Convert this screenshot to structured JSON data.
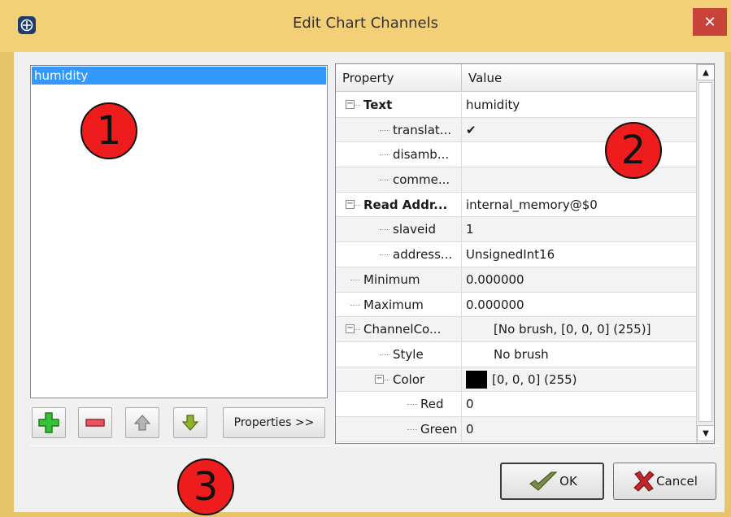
{
  "window": {
    "title": "Edit Chart Channels",
    "close_glyph": "✕"
  },
  "channel_list": {
    "items": [
      {
        "label": "humidity",
        "selected": true
      }
    ]
  },
  "callouts": [
    "1",
    "2",
    "3"
  ],
  "toolbar": {
    "add_icon": "plus-icon",
    "remove_icon": "minus-icon",
    "up_icon": "arrow-up-icon",
    "down_icon": "arrow-down-icon",
    "properties_label": "Properties >>"
  },
  "property_grid": {
    "header": {
      "property": "Property",
      "value": "Value"
    },
    "rows": [
      {
        "property": "Text",
        "value": "humidity",
        "bold": true,
        "level": 0,
        "expander": "⊟"
      },
      {
        "property": "translat...",
        "value": "✔",
        "level": 1
      },
      {
        "property": "disamb...",
        "value": "",
        "level": 1
      },
      {
        "property": "comme...",
        "value": "",
        "level": 1
      },
      {
        "property": "Read Addr...",
        "value": "internal_memory@$0",
        "bold": true,
        "level": 0,
        "expander": "⊟"
      },
      {
        "property": "slaveid",
        "value": "1",
        "level": 1
      },
      {
        "property": "address...",
        "value": "UnsignedInt16",
        "level": 1
      },
      {
        "property": "Minimum",
        "value": "0.000000",
        "level": 0
      },
      {
        "property": "Maximum",
        "value": "0.000000",
        "level": 0
      },
      {
        "property": "ChannelCo...",
        "value": "[No brush, [0, 0, 0] (255)]",
        "level": 0,
        "expander": "⊟"
      },
      {
        "property": "Style",
        "value": "No brush",
        "level": 1
      },
      {
        "property": "Color",
        "value": "[0, 0, 0] (255)",
        "level": 1,
        "expander": "⊟",
        "swatch": "#000000"
      },
      {
        "property": "Red",
        "value": "0",
        "level": 2
      },
      {
        "property": "Green",
        "value": "0",
        "level": 2
      }
    ]
  },
  "buttons": {
    "ok": "OK",
    "cancel": "Cancel"
  },
  "colors": {
    "title_bar": "#f3cf78",
    "selection": "#3399ff",
    "close": "#c8433a",
    "callout": "#ee1c1c"
  }
}
